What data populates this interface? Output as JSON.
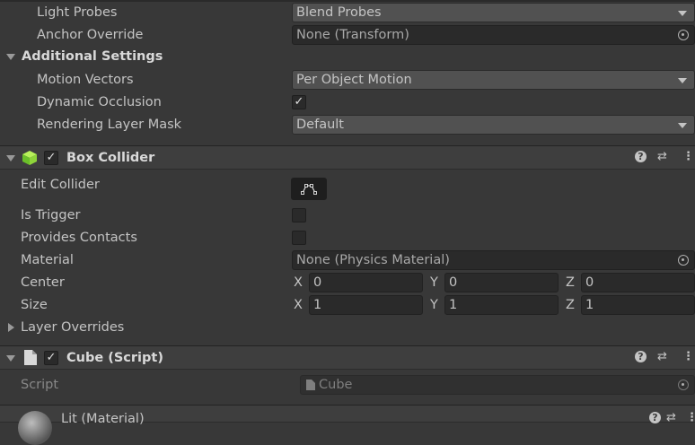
{
  "mesh_renderer": {
    "light_probes": {
      "label": "Light Probes",
      "value": "Blend Probes"
    },
    "anchor_override": {
      "label": "Anchor Override",
      "value": "None (Transform)"
    },
    "additional_settings": {
      "label": "Additional Settings"
    },
    "motion_vectors": {
      "label": "Motion Vectors",
      "value": "Per Object Motion"
    },
    "dynamic_occlusion": {
      "label": "Dynamic Occlusion",
      "checked": true
    },
    "rendering_layer_mask": {
      "label": "Rendering Layer Mask",
      "value": "Default"
    }
  },
  "box_collider": {
    "title": "Box Collider",
    "enabled": true,
    "edit_collider": {
      "label": "Edit Collider"
    },
    "is_trigger": {
      "label": "Is Trigger",
      "checked": false
    },
    "provides_contacts": {
      "label": "Provides Contacts",
      "checked": false
    },
    "material": {
      "label": "Material",
      "value": "None (Physics Material)"
    },
    "center": {
      "label": "Center",
      "x": "0",
      "y": "0",
      "z": "0"
    },
    "size": {
      "label": "Size",
      "x": "1",
      "y": "1",
      "z": "1"
    },
    "layer_overrides": {
      "label": "Layer Overrides"
    },
    "axis_labels": {
      "x": "X",
      "y": "Y",
      "z": "Z"
    }
  },
  "cube_script": {
    "title": "Cube (Script)",
    "enabled": true,
    "script": {
      "label": "Script",
      "value": "Cube"
    }
  },
  "material": {
    "title": "Lit (Material)"
  },
  "icons": {
    "help": "help-icon",
    "presets": "presets-icon",
    "menu": "kebab-menu-icon",
    "collider": "box-collider-icon",
    "script": "script-file-icon",
    "picker": "object-picker-icon"
  }
}
